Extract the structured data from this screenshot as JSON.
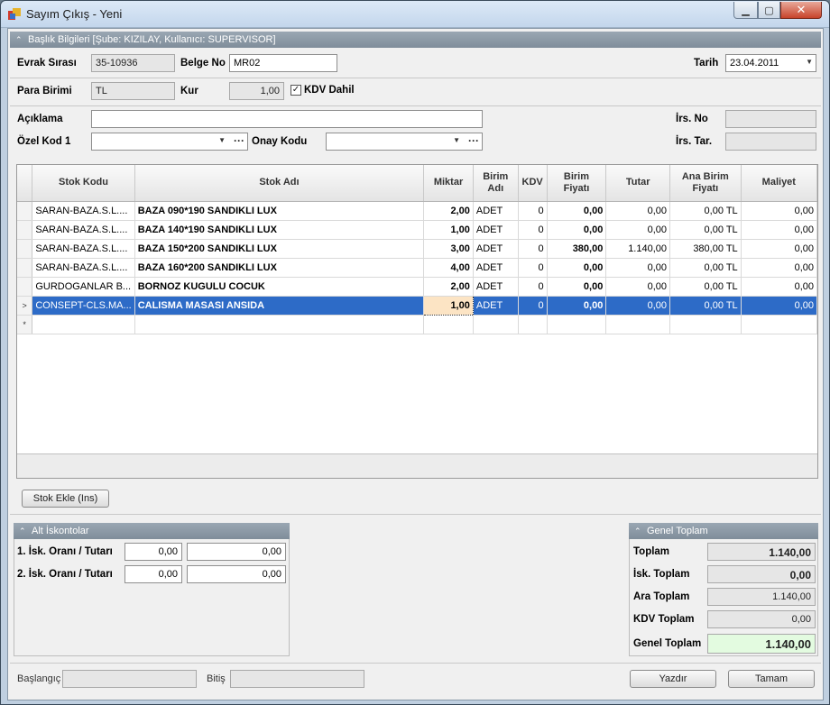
{
  "window": {
    "title": "Sayım Çıkış - Yeni"
  },
  "header": {
    "group_title": "Başlık Bilgileri [Şube: KIZILAY, Kullanıcı: SUPERVISOR]",
    "evrak_sirasi_label": "Evrak Sırası",
    "evrak_sirasi_value": "35-10936",
    "belge_no_label": "Belge No",
    "belge_no_value": "MR02",
    "tarih_label": "Tarih",
    "tarih_value": "23.04.2011",
    "para_birimi_label": "Para Birimi",
    "para_birimi_value": "TL",
    "kur_label": "Kur",
    "kur_value": "1,00",
    "kdv_dahil_label": "KDV Dahil",
    "kdv_dahil_checked": true,
    "aciklama_label": "Açıklama",
    "aciklama_value": "",
    "ozel_kod_label": "Özel Kod 1",
    "ozel_kod_value": "",
    "onay_kodu_label": "Onay Kodu",
    "onay_kodu_value": "",
    "irs_no_label": "İrs. No",
    "irs_no_value": "",
    "irs_tar_label": "İrs. Tar.",
    "irs_tar_value": ""
  },
  "grid": {
    "columns": [
      "Stok Kodu",
      "Stok Adı",
      "Miktar",
      "Birim Adı",
      "KDV",
      "Birim Fiyatı",
      "Tutar",
      "Ana Birim Fiyatı",
      "Maliyet"
    ],
    "rows": [
      {
        "indicator": "",
        "stok_kodu": "SARAN-BAZA.S.L....",
        "stok_adi": "BAZA 090*190 SANDIKLI LUX",
        "miktar": "2,00",
        "birim": "ADET",
        "kdv": "0",
        "birim_fiyati": "0,00",
        "tutar": "0,00",
        "ana_birim_fiyati": "0,00 TL",
        "maliyet": "0,00"
      },
      {
        "indicator": "",
        "stok_kodu": "SARAN-BAZA.S.L....",
        "stok_adi": "BAZA 140*190 SANDIKLI LUX",
        "miktar": "1,00",
        "birim": "ADET",
        "kdv": "0",
        "birim_fiyati": "0,00",
        "tutar": "0,00",
        "ana_birim_fiyati": "0,00 TL",
        "maliyet": "0,00"
      },
      {
        "indicator": "",
        "stok_kodu": "SARAN-BAZA.S.L....",
        "stok_adi": "BAZA 150*200 SANDIKLI LUX",
        "miktar": "3,00",
        "birim": "ADET",
        "kdv": "0",
        "birim_fiyati": "380,00",
        "tutar": "1.140,00",
        "ana_birim_fiyati": "380,00 TL",
        "maliyet": "0,00"
      },
      {
        "indicator": "",
        "stok_kodu": "SARAN-BAZA.S.L....",
        "stok_adi": "BAZA 160*200 SANDIKLI LUX",
        "miktar": "4,00",
        "birim": "ADET",
        "kdv": "0",
        "birim_fiyati": "0,00",
        "tutar": "0,00",
        "ana_birim_fiyati": "0,00 TL",
        "maliyet": "0,00"
      },
      {
        "indicator": "",
        "stok_kodu": "GURDOGANLAR B...",
        "stok_adi": "BORNOZ KUGULU COCUK",
        "miktar": "2,00",
        "birim": "ADET",
        "kdv": "0",
        "birim_fiyati": "0,00",
        "tutar": "0,00",
        "ana_birim_fiyati": "0,00 TL",
        "maliyet": "0,00"
      },
      {
        "indicator": ">",
        "stok_kodu": "CONSEPT-CLS.MA...",
        "stok_adi": "CALISMA MASASI ANSIDA",
        "miktar": "1,00",
        "birim": "ADET",
        "kdv": "0",
        "birim_fiyati": "0,00",
        "tutar": "0,00",
        "ana_birim_fiyati": "0,00 TL",
        "maliyet": "0,00"
      },
      {
        "indicator": "*",
        "stok_kodu": "",
        "stok_adi": "",
        "miktar": "",
        "birim": "",
        "kdv": "",
        "birim_fiyati": "",
        "tutar": "",
        "ana_birim_fiyati": "",
        "maliyet": ""
      }
    ],
    "selected_row": 5
  },
  "actions": {
    "stok_ekle_label": "Stok Ekle (Ins)"
  },
  "discounts": {
    "group_title": "Alt İskontolar",
    "row1_label": "1. İsk. Oranı / Tutarı",
    "row1_rate": "0,00",
    "row1_amount": "0,00",
    "row2_label": "2. İsk. Oranı / Tutarı",
    "row2_rate": "0,00",
    "row2_amount": "0,00"
  },
  "totals": {
    "group_title": "Genel Toplam",
    "toplam_label": "Toplam",
    "toplam_value": "1.140,00",
    "isk_toplam_label": "İsk. Toplam",
    "isk_toplam_value": "0,00",
    "ara_toplam_label": "Ara Toplam",
    "ara_toplam_value": "1.140,00",
    "kdv_toplam_label": "KDV Toplam",
    "kdv_toplam_value": "0,00",
    "genel_toplam_label": "Genel Toplam",
    "genel_toplam_value": "1.140,00"
  },
  "footer": {
    "baslangic_label": "Başlangıç",
    "baslangic_value": "",
    "bitis_label": "Bitiş",
    "bitis_value": "",
    "yazdir_label": "Yazdır",
    "tamam_label": "Tamam"
  }
}
